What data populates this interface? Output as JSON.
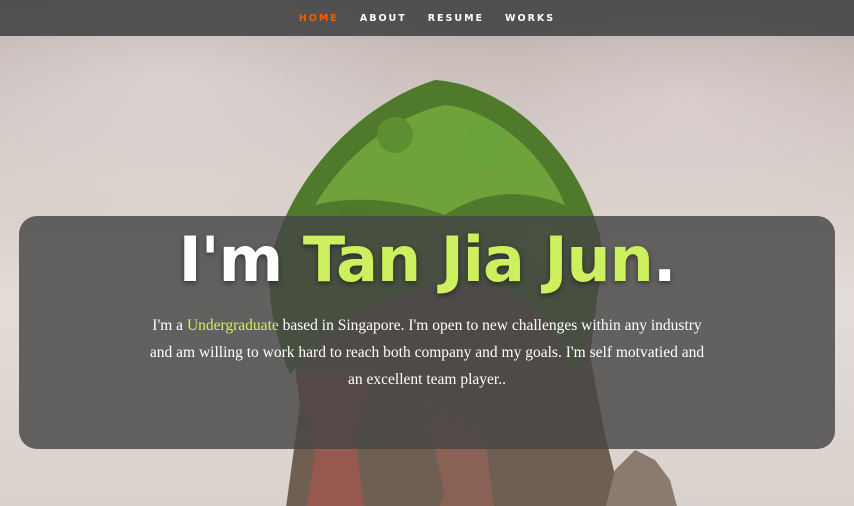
{
  "nav": {
    "items": [
      {
        "label": "HOME",
        "active": true
      },
      {
        "label": "ABOUT",
        "active": false
      },
      {
        "label": "RESUME",
        "active": false
      },
      {
        "label": "WORKS",
        "active": false
      }
    ],
    "active_color": "#f06000"
  },
  "hero": {
    "greeting": "I'm",
    "name": "Tan Jia Jun",
    "period": ".",
    "intro_before": "I'm a",
    "intro_role": "Undergraduate",
    "intro_after": "based in Singapore. I'm open to new challenges within any industry and am willing to work hard to reach both company and my goals. I'm self motvatied and an excellent team player..",
    "accent_color": "#cdf05f"
  }
}
